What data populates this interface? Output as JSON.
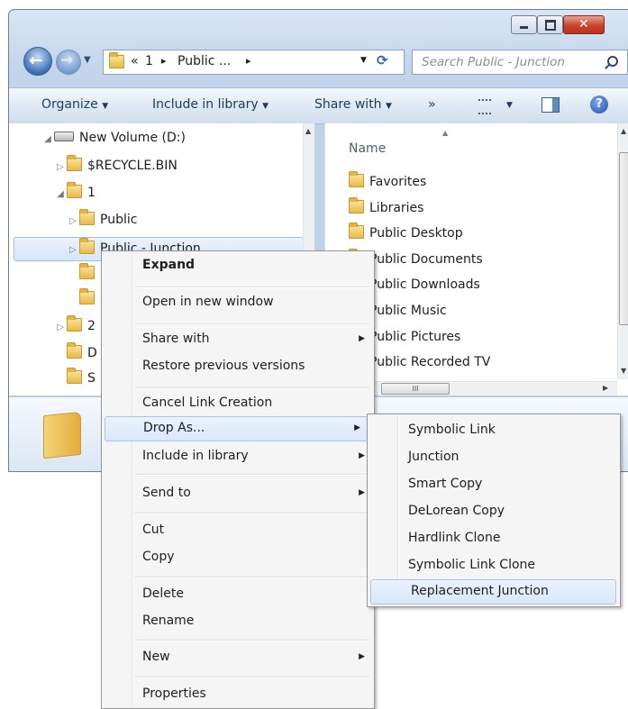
{
  "window": {
    "address": {
      "segments": [
        "«",
        "1",
        "Public ..."
      ],
      "separator": "▸"
    },
    "search_placeholder": "Search Public - Junction"
  },
  "toolbar": {
    "organize": "Organize",
    "include_in_library": "Include in library",
    "share_with": "Share with",
    "more": "»"
  },
  "nav_tree": [
    {
      "label": "New Volume (D:)",
      "expanded": true,
      "icon": "drive-icon"
    },
    {
      "label": "$RECYCLE.BIN",
      "expanded": false,
      "icon": "folder-icon"
    },
    {
      "label": "1",
      "expanded": true,
      "icon": "folder-icon"
    },
    {
      "label": "Public",
      "expanded": false,
      "icon": "folder-icon"
    },
    {
      "label": "Public - Junction",
      "expanded": false,
      "icon": "junction-folder-icon",
      "selected": true
    },
    {
      "label": "",
      "icon": "folder-icon"
    },
    {
      "label": "",
      "icon": "folder-icon"
    },
    {
      "label": "2",
      "expanded": false,
      "icon": "folder-icon"
    },
    {
      "label": "D",
      "icon": "folder-icon"
    },
    {
      "label": "S",
      "icon": "folder-icon"
    }
  ],
  "file_list": {
    "column_header": "Name",
    "items": [
      "Favorites",
      "Libraries",
      "Public Desktop",
      "Public Documents",
      "Public Downloads",
      "Public Music",
      "Public Pictures",
      "Public Recorded TV"
    ],
    "hscroll_label": "III"
  },
  "context_menu": {
    "items": [
      {
        "label": "Expand",
        "bold": true
      },
      {
        "label": "Open in new window"
      },
      {
        "label": "Share with",
        "submenu": true
      },
      {
        "label": "Restore previous versions"
      },
      {
        "label": "Cancel Link Creation"
      },
      {
        "label": "Drop As...",
        "submenu": true,
        "highlighted": true
      },
      {
        "label": "Include in library",
        "submenu": true
      },
      {
        "label": "Send to",
        "submenu": true
      },
      {
        "label": "Cut"
      },
      {
        "label": "Copy"
      },
      {
        "label": "Delete"
      },
      {
        "label": "Rename"
      },
      {
        "label": "New",
        "submenu": true
      },
      {
        "label": "Properties"
      }
    ]
  },
  "drop_as_submenu": {
    "items": [
      {
        "label": "Symbolic Link"
      },
      {
        "label": "Junction"
      },
      {
        "label": "Smart Copy"
      },
      {
        "label": "DeLorean Copy"
      },
      {
        "label": "Hardlink Clone"
      },
      {
        "label": "Symbolic Link Clone"
      },
      {
        "label": "Replacement Junction",
        "highlighted": true
      }
    ]
  },
  "colors": {
    "selection": "#d9e8fb",
    "selection_border": "#a6c5ee",
    "window_frame": "#bfd2ea",
    "close_button": "#c7432a"
  }
}
